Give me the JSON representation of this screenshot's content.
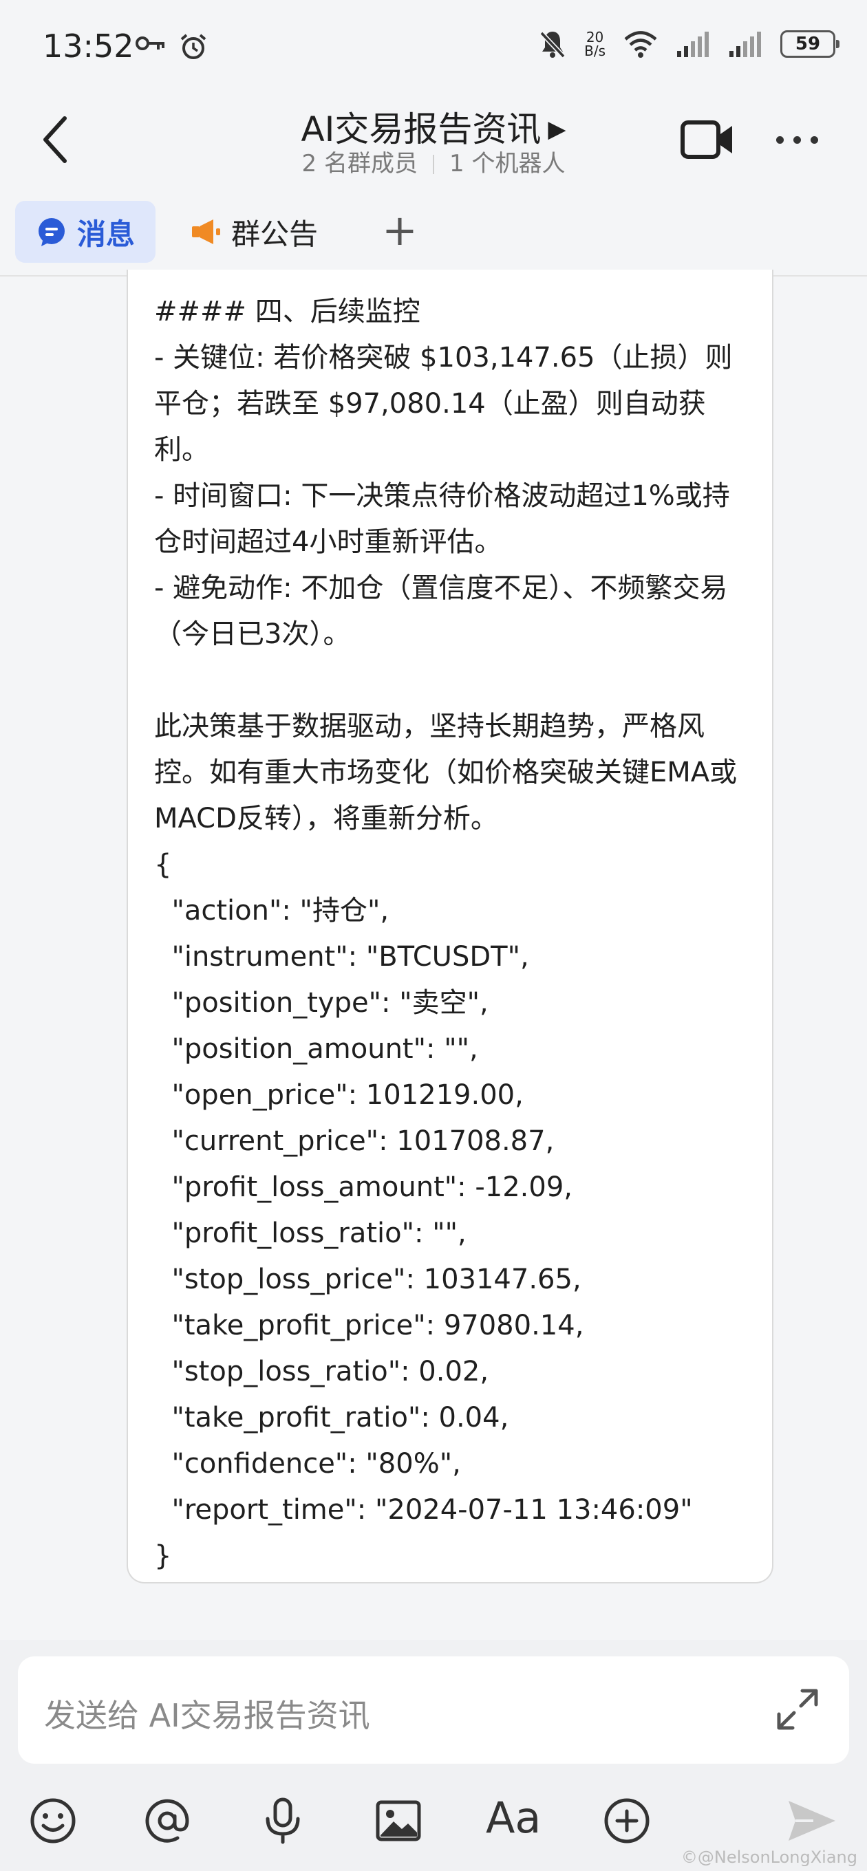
{
  "status_bar": {
    "time": "13:52",
    "net_speed_value": "20",
    "net_speed_unit": "B/s",
    "battery": "59"
  },
  "header": {
    "title": "AI交易报告资讯",
    "members": "2 名群成员",
    "bots": "1 个机器人"
  },
  "tabs": {
    "messages": "消息",
    "announcement": "群公告",
    "add": "+"
  },
  "message": {
    "text": "#### 四、后续监控\n- 关键位: 若价格突破 $103,147.65（止损）则平仓；若跌至 $97,080.14（止盈）则自动获利。\n- 时间窗口: 下一决策点待价格波动超过1%或持仓时间超过4小时重新评估。\n- 避免动作: 不加仓（置信度不足）、不频繁交易（今日已3次）。\n\n此决策基于数据驱动，坚持长期趋势，严格风控。如有重大市场变化（如价格突破关键EMA或MACD反转），将重新分析。\n{\n  \"action\": \"持仓\",\n  \"instrument\": \"BTCUSDT\",\n  \"position_type\": \"卖空\",\n  \"position_amount\": \"\",\n  \"open_price\": 101219.00,\n  \"current_price\": 101708.87,\n  \"profit_loss_amount\": -12.09,\n  \"profit_loss_ratio\": \"\",\n  \"stop_loss_price\": 103147.65,\n  \"take_profit_price\": 97080.14,\n  \"stop_loss_ratio\": 0.02,\n  \"take_profit_ratio\": 0.04,\n  \"confidence\": \"80%\",\n  \"report_time\": \"2024-07-11 13:46:09\"\n}"
  },
  "composer": {
    "placeholder": "发送给 AI交易报告资讯",
    "font_button": "Aa"
  },
  "watermark": "©@NelsonLongXiang",
  "colors": {
    "accent": "#2a5bd7",
    "announcement_icon": "#f08a24",
    "tab_active_bg": "#dfe7fb"
  }
}
